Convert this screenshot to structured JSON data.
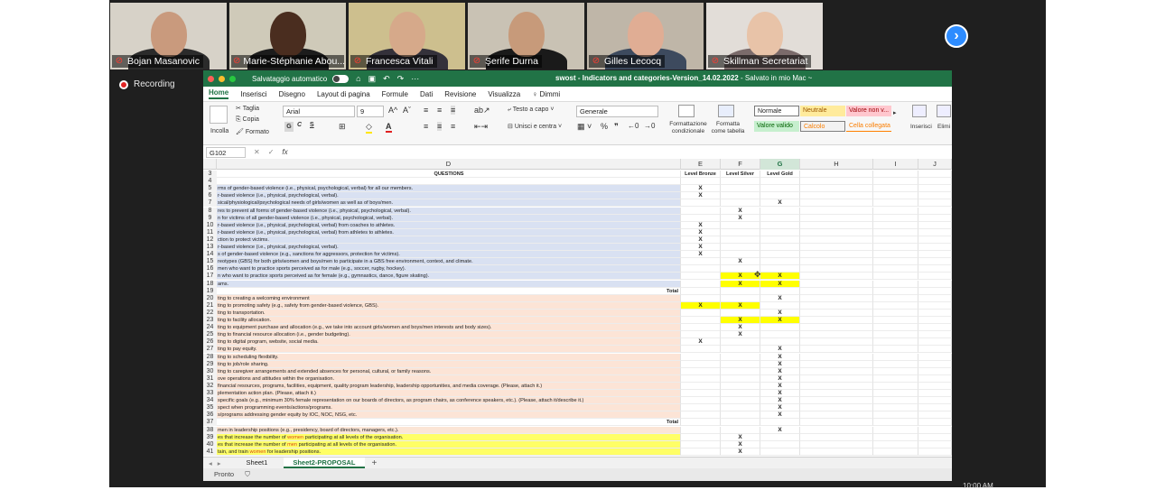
{
  "meeting": {
    "recording_label": "Recording",
    "participants": [
      {
        "name": "Bojan Masanovic",
        "bg": "#d7d2c8",
        "skin": "#c99a7d",
        "shirt": "#2b2b2b",
        "active": false
      },
      {
        "name": "Marie-Stéphanie Abou...",
        "bg": "#cfcab9",
        "skin": "#4a2d1f",
        "shirt": "#1c1c1c",
        "active": false
      },
      {
        "name": "Francesca Vitali",
        "bg": "#cdbf8e",
        "skin": "#d6a98a",
        "shirt": "#34313a",
        "active": true
      },
      {
        "name": "Şerife Durna",
        "bg": "#c9c2b4",
        "skin": "#c79a7a",
        "shirt": "#1a1a1a",
        "active": false
      },
      {
        "name": "Gilles Lecocq",
        "bg": "#bfb6a8",
        "skin": "#e0ad94",
        "shirt": "#3d4a5e",
        "active": false
      },
      {
        "name": "Skillman Secretariat",
        "bg": "#e2ddd8",
        "skin": "#e8c3a8",
        "shirt": "#7b6b6b",
        "active": false
      }
    ],
    "next_icon": "›"
  },
  "excel": {
    "autosave_label": "Salvataggio automatico",
    "doc_title_bold": "swost - Indicators and categories-Version_14.02.2022",
    "doc_title_suffix": " - Salvato in mio Mac ~",
    "tabs": [
      "Home",
      "Inserisci",
      "Disegno",
      "Layout di pagina",
      "Formule",
      "Dati",
      "Revisione",
      "Visualizza",
      "Dimmi"
    ],
    "clipboard": {
      "paste": "Incolla",
      "cut": "Taglia",
      "copy": "Copia",
      "format": "Formato"
    },
    "font": {
      "name": "Arial",
      "size": "9"
    },
    "wrap_label": "Testo a capo",
    "merge_label": "Unisci e centra",
    "number_format": "Generale",
    "cond_format_label": "Formattazione condizionale",
    "table_format_label": "Formatta come tabella",
    "styles": [
      "Normale",
      "Neutrale",
      "Valore non v...",
      "Valore valido",
      "Calcolo",
      "Cella collegata"
    ],
    "insert_label": "Inserisci",
    "delete_label": "Elimi",
    "name_box": "G102",
    "fx_label": "fx",
    "columns": [
      "D",
      "E",
      "F",
      "G",
      "H",
      "I",
      "J"
    ],
    "sheet_tabs": [
      "Sheet1",
      "Sheet2-PROPOSAL"
    ],
    "status": "Pronto"
  },
  "sheet": {
    "header_row": {
      "n": "3",
      "D": "QUESTIONS",
      "E": "Level Bronze",
      "F": "Level Silver",
      "G": "Level Gold"
    },
    "rows": [
      {
        "n": "4",
        "D": "",
        "E": "",
        "F": "",
        "G": "",
        "fill": "none"
      },
      {
        "n": "5",
        "D": "rms of gender-based violence (i.e., physical, psychological, verbal) for all our members.",
        "E": "X",
        "F": "",
        "G": "",
        "fill": "blue"
      },
      {
        "n": "6",
        "D": "r-based violence (i.e., physical, psychological, verbal).",
        "E": "X",
        "F": "",
        "G": "",
        "fill": "blue"
      },
      {
        "n": "7",
        "D": "sical/physiological/psychological needs of girls/women as well as of boys/men.",
        "E": "",
        "F": "",
        "G": "X",
        "fill": "blue"
      },
      {
        "n": "8",
        "D": "res to prevent all forms of gender-based violence (i.e., physical, psychological, verbal).",
        "E": "",
        "F": "X",
        "G": "",
        "fill": "blue"
      },
      {
        "n": "9",
        "D": "n for victims of all gender-based violence (i.e., physical, psychological, verbal).",
        "E": "",
        "F": "X",
        "G": "",
        "fill": "blue"
      },
      {
        "n": "10",
        "D": "r-based violence (i.e., physical, psychological, verbal) from coaches to athletes.",
        "E": "X",
        "F": "",
        "G": "",
        "fill": "blue"
      },
      {
        "n": "11",
        "D": "r-based violence (i.e., physical, psychological, verbal) from athletes to athletes.",
        "E": "X",
        "F": "",
        "G": "",
        "fill": "blue"
      },
      {
        "n": "12",
        "D": "ction to protect victims.",
        "E": "X",
        "F": "",
        "G": "",
        "fill": "blue"
      },
      {
        "n": "13",
        "D": "r-based violence (i.e., physical, psychological, verbal).",
        "E": "X",
        "F": "",
        "G": "",
        "fill": "blue"
      },
      {
        "n": "14",
        "D": "s of gender-based violence (e.g., sanctions for aggressors, protection for victims).",
        "E": "X",
        "F": "",
        "G": "",
        "fill": "blue"
      },
      {
        "n": "15",
        "D": "reotypes (GBS) for both girls/women and boys/men to participate in a GBS free environment, context, and climate.",
        "E": "",
        "F": "X",
        "G": "",
        "fill": "blue"
      },
      {
        "n": "16",
        "D": "men who want to practice sports perceived as for male (e.g., soccer, rugby, hockey).",
        "E": "",
        "F": "",
        "G": "",
        "fill": "blue"
      },
      {
        "n": "17",
        "D": "n who want to practice sports perceived as for female (e.g., gymnastics, dance, figure skating).",
        "E": "",
        "F": "X",
        "G": "X",
        "fill": "blue",
        "hlF": true,
        "hlG": true
      },
      {
        "n": "18",
        "D": "ams.",
        "E": "",
        "F": "X",
        "G": "X",
        "fill": "blue",
        "hlF": true,
        "hlG": true
      },
      {
        "n": "19",
        "D": "Total",
        "E": "",
        "F": "",
        "G": "",
        "fill": "none",
        "total": true
      },
      {
        "n": "20",
        "D": "ting to creating a welcoming environment",
        "E": "",
        "F": "",
        "G": "X",
        "fill": "pink"
      },
      {
        "n": "21",
        "D": "ting to promoting safety (e.g., safety from gender-based violence, GBS).",
        "E": "X",
        "F": "X",
        "G": "",
        "fill": "pink",
        "hlE": true,
        "hlF": true
      },
      {
        "n": "22",
        "D": "ting to transportation.",
        "E": "",
        "F": "",
        "G": "X",
        "fill": "pink"
      },
      {
        "n": "23",
        "D": "ting to facility allocation.",
        "E": "",
        "F": "X",
        "G": "X",
        "fill": "pink",
        "hlF": true,
        "hlG": true
      },
      {
        "n": "24",
        "D": "ting to equipment purchase and allocation (e.g., we take into account girls/women and boys/men interests and body sizes).",
        "E": "",
        "F": "X",
        "G": "",
        "fill": "pink"
      },
      {
        "n": "25",
        "D": "ting to financial resource allocation (i.e., gender budgeting).",
        "E": "",
        "F": "X",
        "G": "",
        "fill": "pink"
      },
      {
        "n": "26",
        "D": "ting to digital program, website, social media.",
        "E": "X",
        "F": "",
        "G": "",
        "fill": "pink"
      },
      {
        "n": "27",
        "D": "ting to pay equity.",
        "E": "",
        "F": "",
        "G": "X",
        "fill": "pink"
      },
      {
        "n": "28",
        "D": "ting to scheduling flexibility.",
        "E": "",
        "F": "",
        "G": "X",
        "fill": "pink"
      },
      {
        "n": "29",
        "D": "ting to job/role sharing.",
        "E": "",
        "F": "",
        "G": "X",
        "fill": "pink"
      },
      {
        "n": "30",
        "D": "ting to caregiver arrangements and extended absences for personal, cultural, or family reasons.",
        "E": "",
        "F": "",
        "G": "X",
        "fill": "pink"
      },
      {
        "n": "31",
        "D": "ove operations and attitudes within the organisation.",
        "E": "",
        "F": "",
        "G": "X",
        "fill": "pink"
      },
      {
        "n": "32",
        "D": "financial resources, programs, facilities, equipment, quality program leadership, leadership opportunities, and media coverage. (Please, attach it.)",
        "E": "",
        "F": "",
        "G": "X",
        "fill": "pink"
      },
      {
        "n": "33",
        "D": "plementation action plan. (Please, attach it.)",
        "E": "",
        "F": "",
        "G": "X",
        "fill": "pink"
      },
      {
        "n": "34",
        "D": "specific goals (e.g., minimum 30% female representation on our boards of directors, as program chairs, as conference speakers, etc.). (Please, attach it/describe it.)",
        "E": "",
        "F": "",
        "G": "X",
        "fill": "pink"
      },
      {
        "n": "35",
        "D": "spect when programming events/actions/programs.",
        "E": "",
        "F": "",
        "G": "X",
        "fill": "pink"
      },
      {
        "n": "36",
        "D": "s/programs addressing gender equity by IOC, NOC, NSG, etc.",
        "E": "",
        "F": "",
        "G": "X",
        "fill": "pink"
      },
      {
        "n": "37",
        "D": "Total",
        "E": "",
        "F": "",
        "G": "",
        "fill": "none",
        "total": true
      },
      {
        "n": "38",
        "D": "men in leadership positions (e.g., presidency, board of directors, managers, etc.).",
        "E": "",
        "F": "",
        "G": "X",
        "fill": "peach"
      },
      {
        "n": "39",
        "D": "es that increase the number of women participating at all levels of the organisation.",
        "E": "",
        "F": "X",
        "G": "",
        "fill": "yellow"
      },
      {
        "n": "40",
        "D": "es that increase the number of men participating at all levels of the organisation.",
        "E": "",
        "F": "X",
        "G": "",
        "fill": "yellow"
      },
      {
        "n": "41",
        "D": "tain, and train women for leadership positions.",
        "E": "",
        "F": "X",
        "G": "",
        "fill": "yellow"
      }
    ]
  },
  "colors": {
    "excel_green": "#217346",
    "blue_fill": "#d9e1f2",
    "pink_fill": "#fce4d6",
    "peach_fill": "#fbe5d6",
    "yellow_fill": "#ffff66",
    "highlight": "#ffff00"
  },
  "clock": "10:00 AM"
}
